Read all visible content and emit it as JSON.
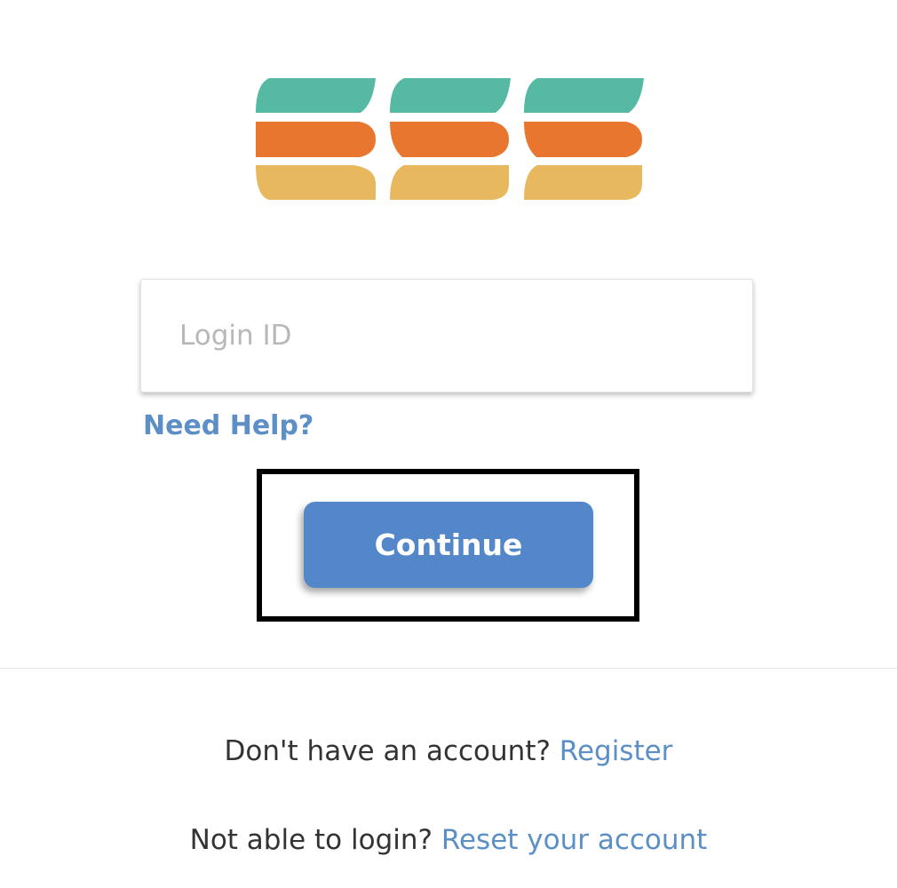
{
  "logo": {
    "icon": "ess-logo",
    "colors": {
      "top": "#55b9a3",
      "middle": "#e8762f",
      "bottom": "#e8b85e"
    }
  },
  "login": {
    "placeholder": "Login ID",
    "value": ""
  },
  "help": {
    "label": "Need Help?"
  },
  "continue": {
    "label": "Continue"
  },
  "footer": {
    "register_prompt": "Don't have an account?",
    "register_link": "Register",
    "reset_prompt": "Not able to login?",
    "reset_link": "Reset your account"
  },
  "colors": {
    "link": "#5b8fc6",
    "button": "#5487c9",
    "highlight_frame": "#000000"
  }
}
